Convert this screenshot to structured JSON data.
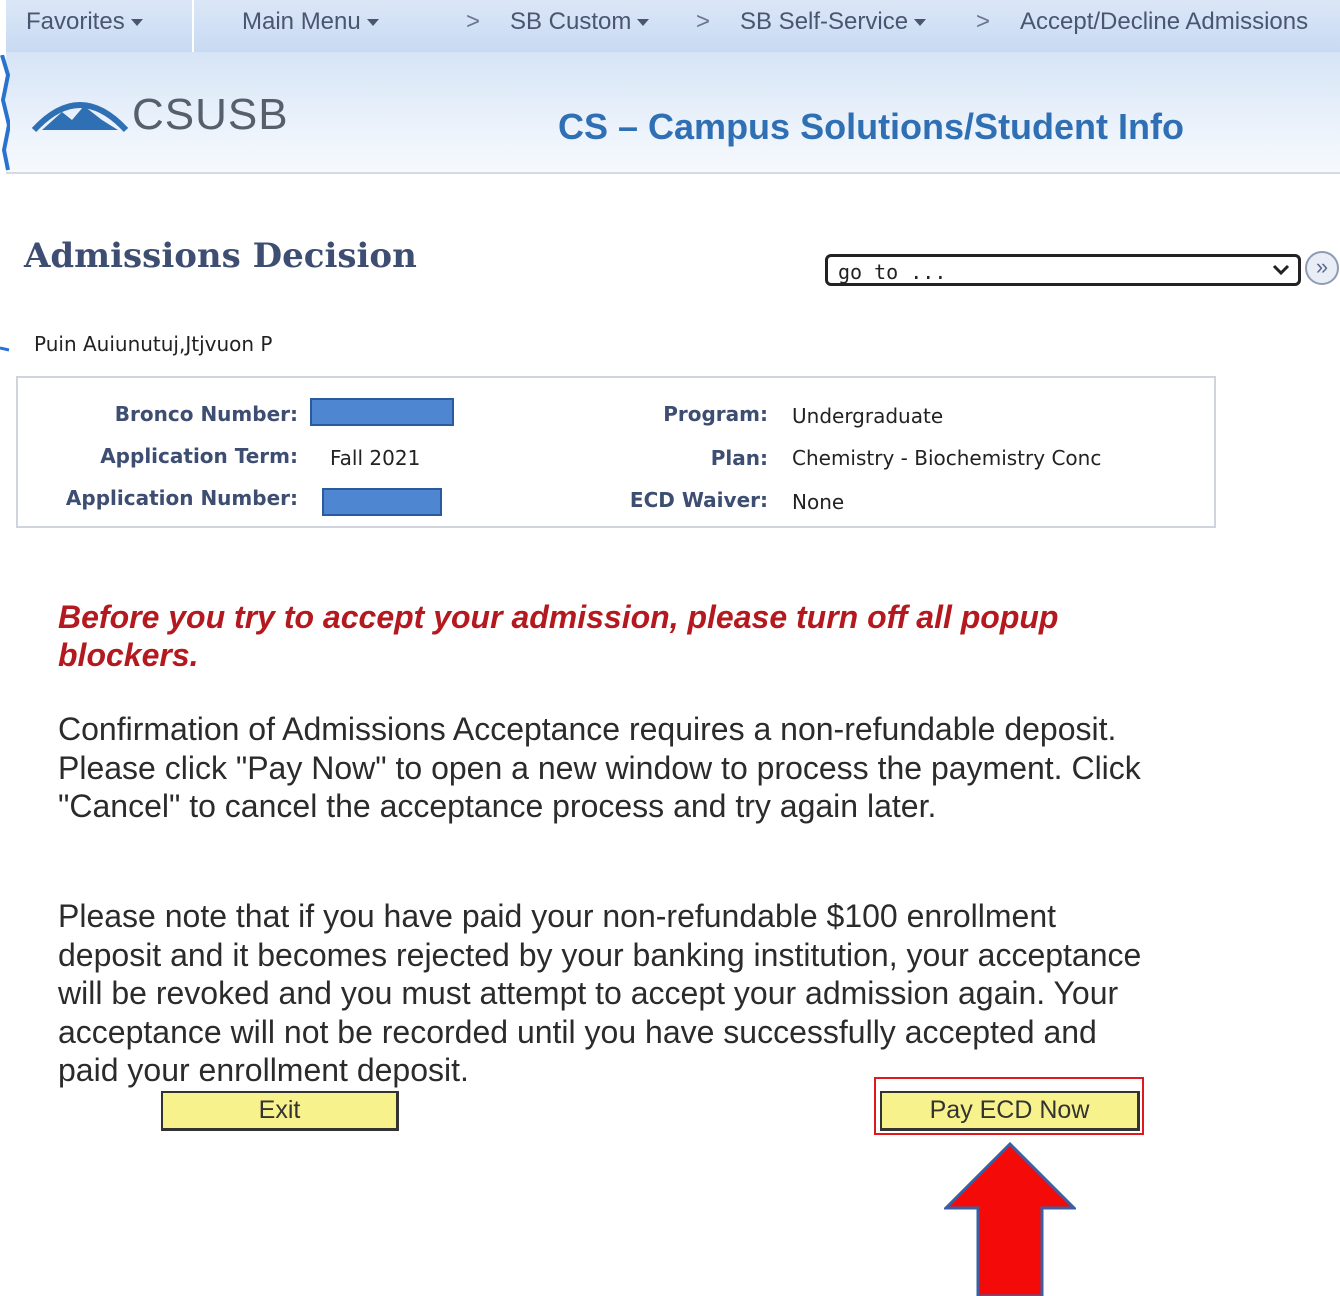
{
  "nav": {
    "favorites": "Favorites",
    "main_menu": "Main Menu",
    "sep": ">",
    "sb_custom": "SB Custom",
    "sb_self_service": "SB Self-Service",
    "accept_decline": "Accept/Decline Admissions"
  },
  "header": {
    "logo_text": "CSUSB",
    "title": "CS – Campus Solutions/Student Info"
  },
  "page": {
    "title": "Admissions Decision",
    "goto_selected": "go to ...",
    "goto_button": "»",
    "student_name": "Puin Auiunutuj,Jtjvuon P"
  },
  "info": {
    "bronco_number_label": "Bronco Number:",
    "application_term_label": "Application Term:",
    "application_term_value": "Fall 2021",
    "application_number_label": "Application Number:",
    "program_label": "Program:",
    "program_value": "Undergraduate",
    "plan_label": "Plan:",
    "plan_value": "Chemistry - Biochemistry Conc",
    "ecd_waiver_label": "ECD Waiver:",
    "ecd_waiver_value": "None"
  },
  "messages": {
    "warning": "Before you try to accept your admission, please turn off all popup blockers.",
    "paragraph1": "Confirmation of Admissions Acceptance requires a non-refundable deposit. Please click \"Pay Now\" to open a new window to process the payment. Click \"Cancel\" to cancel the acceptance process and try again later.",
    "paragraph2": "Please note that if you have paid your non-refundable $100 enrollment deposit and it becomes rejected by your banking institution, your acceptance will be revoked and you must attempt to accept your admission again. Your acceptance will not be recorded until you have successfully accepted and paid your enrollment deposit."
  },
  "buttons": {
    "exit": "Exit",
    "pay": "Pay ECD Now"
  },
  "colors": {
    "button_bg": "#f7f28c",
    "warning_text": "#b3191e",
    "header_title": "#2f6fb3",
    "highlight": "#e0191f",
    "redaction": "#4f86d2"
  },
  "icons": {
    "goto_caret": "chevron-down-icon",
    "goto_button": "double-chevron-right-icon",
    "annotation_arrow": "red-up-arrow-icon",
    "logo": "mountain-logo-icon"
  }
}
